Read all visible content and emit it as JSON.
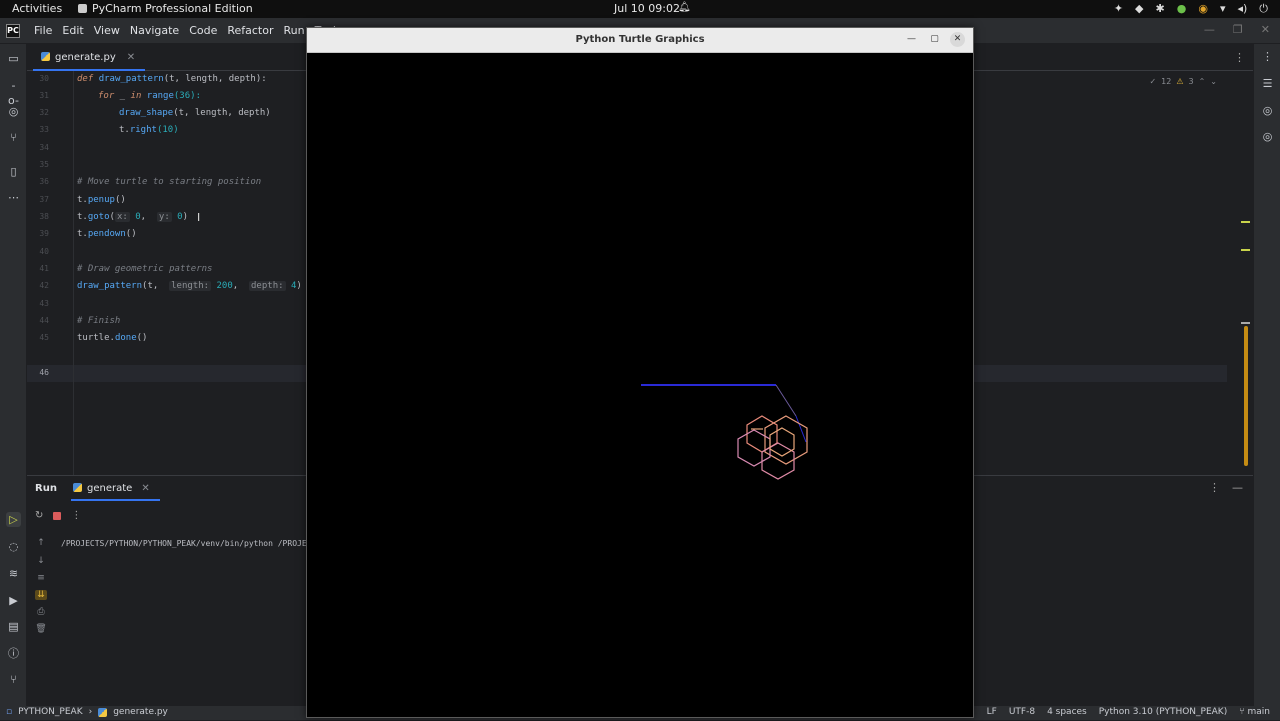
{
  "system_bar": {
    "activities": "Activities",
    "app_name": "PyCharm Professional Edition",
    "clock": "Jul 10  09:02"
  },
  "menu": {
    "items": [
      "File",
      "Edit",
      "View",
      "Navigate",
      "Code",
      "Refactor",
      "Run",
      "Tools"
    ]
  },
  "editor": {
    "tab": "generate.py",
    "inspections": {
      "weak_warnings": "12",
      "warnings": "3"
    },
    "line_numbers": [
      "30",
      "31",
      "32",
      "33",
      "34",
      "35",
      "36",
      "37",
      "38",
      "39",
      "40",
      "41",
      "42",
      "43",
      "44",
      "45",
      "46"
    ],
    "code": {
      "def_kw": "def",
      "def_name": "draw_pattern",
      "def_args": "(t, length, depth):",
      "for_kw": "for",
      "for_var": " _ ",
      "in_kw": "in",
      "range_fn": "range",
      "range_args": "(36):",
      "draw_shape": "draw_shape",
      "draw_shape_args": "(t, length, depth)",
      "t_right_obj": "t.",
      "t_right_fn": "right",
      "t_right_args": "(10)",
      "comment_move": "# Move turtle to starting position",
      "penup_obj": "t.",
      "penup_fn": "penup",
      "penup_args": "()",
      "goto_obj": "t.",
      "goto_fn": "goto",
      "goto_open": "(",
      "hint_x": "x:",
      "goto_x": "0",
      "goto_sep": ",  ",
      "hint_y": "y:",
      "goto_y": "0",
      "goto_close": ")",
      "pendown_obj": "t.",
      "pendown_fn": "pendown",
      "pendown_args": "()",
      "comment_draw": "# Draw geometric patterns",
      "dp_fn": "draw_pattern",
      "dp_open": "(t,  ",
      "hint_length": "length:",
      "dp_length": "200",
      "dp_sep": ",  ",
      "hint_depth": "depth:",
      "dp_depth": "4",
      "dp_close": ")",
      "comment_finish": "# Finish",
      "done_obj": "turtle.",
      "done_fn": "done",
      "done_args": "()"
    }
  },
  "run_panel": {
    "title": "Run",
    "tab": "generate",
    "console_line": "/PROJECTS/PYTHON/PYTHON_PEAK/venv/bin/python /PROJECT"
  },
  "turtle_window": {
    "title": "Python Turtle Graphics"
  },
  "status_bar": {
    "project": "PYTHON_PEAK",
    "file": "generate.py",
    "line_sep": "LF",
    "encoding": "UTF-8",
    "indent": "4 spaces",
    "interpreter": "Python 3.10 (PYTHON_PEAK)",
    "branch": "main"
  },
  "colors": {
    "accent": "#3574f0",
    "keyword": "#cf8e6d",
    "function": "#56a8f5",
    "number": "#2aacb8",
    "comment": "#7a7e85"
  }
}
